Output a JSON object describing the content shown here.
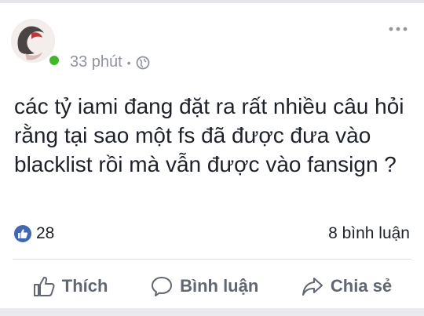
{
  "post": {
    "timestamp": "33 phút",
    "separator": "•",
    "privacy_icon": "globe-icon",
    "more_icon": "more-horizontal-icon",
    "text": "các tỷ iami đang đặt ra rất nhiều câu hỏi rằng tại sao một fs đã được đưa vào blacklist rồi mà vẫn được vào fansign ?",
    "status_color": "#42b72a"
  },
  "stats": {
    "like_count": "28",
    "comment_count": "8 bình luận",
    "like_icon": "like-badge-icon"
  },
  "actions": [
    {
      "label": "Thích",
      "icon": "thumbs-up-icon"
    },
    {
      "label": "Bình luận",
      "icon": "comment-icon"
    },
    {
      "label": "Chia sẻ",
      "icon": "share-icon"
    }
  ],
  "colors": {
    "brand": "#4267b2",
    "text_primary": "#1d2129",
    "text_secondary": "#90949c",
    "action_text": "#606770"
  }
}
